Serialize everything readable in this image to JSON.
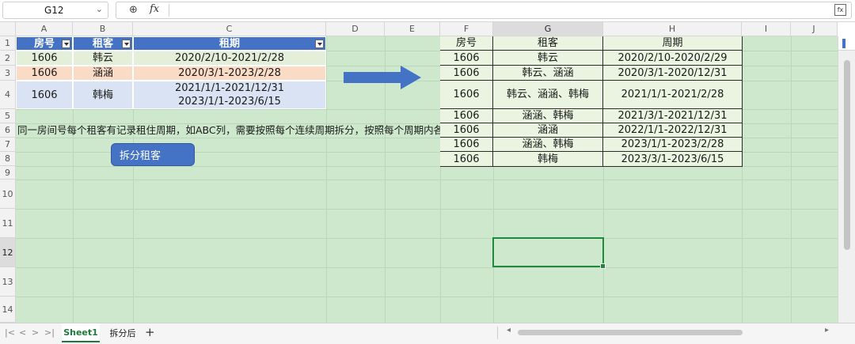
{
  "formula_bar": {
    "name_box": "G12",
    "fx_label": "fx",
    "formula": ""
  },
  "columns": [
    "A",
    "B",
    "C",
    "D",
    "E",
    "F",
    "G",
    "H",
    "I",
    "J"
  ],
  "rows": [
    "1",
    "2",
    "3",
    "4",
    "5",
    "6",
    "7",
    "8",
    "9",
    "10",
    "11",
    "12",
    "13",
    "14"
  ],
  "selected_cell": "G12",
  "source_table": {
    "headers": [
      "房号",
      "租客",
      "租期"
    ],
    "rows": [
      {
        "room": "1606",
        "tenant": "韩云",
        "period": "2020/2/10-2021/2/28"
      },
      {
        "room": "1606",
        "tenant": "涵涵",
        "period": "2020/3/1-2023/2/28"
      },
      {
        "room": "1606",
        "tenant": "韩梅",
        "period_line1": "2021/1/1-2021/12/31",
        "period_line2": "2023/1/1-2023/6/15"
      }
    ]
  },
  "description": "同一房间号每个租客有记录租住周期，如ABC列，需要按照每个连续周期拆分，按照每个周期内各租客",
  "split_button": "拆分租客",
  "result_table": {
    "headers": [
      "房号",
      "租客",
      "周期"
    ],
    "rows": [
      {
        "room": "1606",
        "tenant": "韩云",
        "period": "2020/2/10-2020/2/29"
      },
      {
        "room": "1606",
        "tenant": "韩云、涵涵",
        "period": "2020/3/1-2020/12/31"
      },
      {
        "room": "1606",
        "tenant": "韩云、涵涵、韩梅",
        "period": "2021/1/1-2021/2/28"
      },
      {
        "room": "1606",
        "tenant": "涵涵、韩梅",
        "period": "2021/3/1-2021/12/31"
      },
      {
        "room": "1606",
        "tenant": "涵涵",
        "period": "2022/1/1-2022/12/31"
      },
      {
        "room": "1606",
        "tenant": "涵涵、韩梅",
        "period": "2023/1/1-2023/2/28"
      },
      {
        "room": "1606",
        "tenant": "韩梅",
        "period": "2023/3/1-2023/6/15"
      }
    ]
  },
  "sheet_tabs": [
    "Sheet1",
    "拆分后"
  ],
  "active_tab": "Sheet1",
  "colors": {
    "sheet_background": "#cde8cc",
    "header_blue": "#4472c4",
    "selection_green": "#1e8b3c"
  }
}
